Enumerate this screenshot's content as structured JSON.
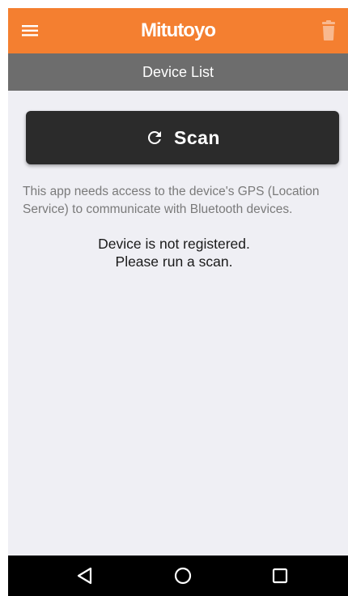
{
  "app_bar": {
    "logo_text": "Mitutoyo",
    "menu_icon": "hamburger-menu-icon",
    "delete_icon": "trash-icon",
    "color": "#f47f30"
  },
  "sub_bar": {
    "title": "Device List",
    "color": "#6d6d6d"
  },
  "scan_button": {
    "label": "Scan",
    "icon": "refresh-icon"
  },
  "notice_text": "This app needs access to the device's GPS (Location Service) to communicate with Bluetooth devices.",
  "status": {
    "line1": "Device is not registered.",
    "line2": "Please run a scan."
  },
  "nav_bar": {
    "back_icon": "back-triangle-icon",
    "home_icon": "home-circle-icon",
    "recents_icon": "recents-square-icon"
  }
}
